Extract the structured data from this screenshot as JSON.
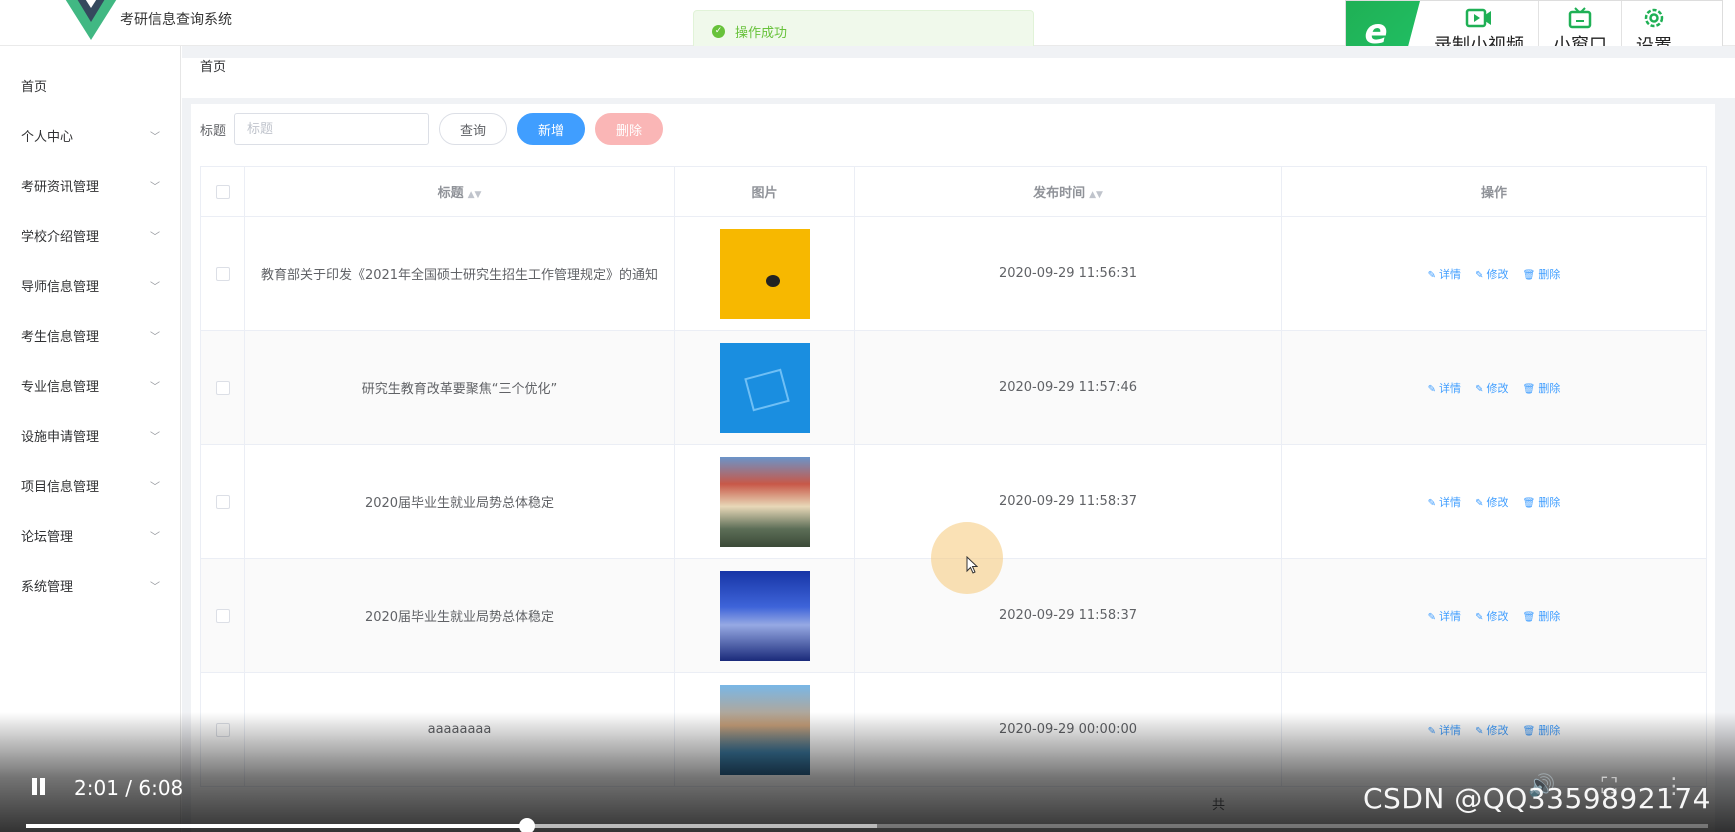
{
  "header": {
    "app_title": "考研信息查询系统",
    "toast": "操作成功"
  },
  "ext_toolbar": {
    "items": [
      {
        "label": "录制小视频",
        "icon": "video-record-icon"
      },
      {
        "label": "小窗口",
        "icon": "tv-icon"
      },
      {
        "label": "设置",
        "icon": "gear-icon"
      }
    ]
  },
  "sidebar": {
    "items": [
      {
        "label": "首页",
        "expandable": false
      },
      {
        "label": "个人中心",
        "expandable": true
      },
      {
        "label": "考研资讯管理",
        "expandable": true
      },
      {
        "label": "学校介绍管理",
        "expandable": true
      },
      {
        "label": "导师信息管理",
        "expandable": true
      },
      {
        "label": "考生信息管理",
        "expandable": true
      },
      {
        "label": "专业信息管理",
        "expandable": true
      },
      {
        "label": "设施申请管理",
        "expandable": true
      },
      {
        "label": "项目信息管理",
        "expandable": true
      },
      {
        "label": "论坛管理",
        "expandable": true
      },
      {
        "label": "系统管理",
        "expandable": true
      }
    ]
  },
  "breadcrumb": "首页",
  "search": {
    "label": "标题",
    "placeholder": "标题",
    "value": "",
    "query_label": "查询",
    "add_label": "新增",
    "delete_label": "删除"
  },
  "table": {
    "headers": {
      "title": "标题",
      "image": "图片",
      "time": "发布时间",
      "ops": "操作"
    },
    "actions": {
      "detail": "详情",
      "edit": "修改",
      "delete": "删除"
    },
    "rows": [
      {
        "title": "教育部关于印发《2021年全国硕士研究生招生工作管理规定》的通知",
        "time": "2020-09-29 11:56:31"
      },
      {
        "title": "研究生教育改革要聚焦“三个优化”",
        "time": "2020-09-29 11:57:46"
      },
      {
        "title": "2020届毕业生就业局势总体稳定",
        "time": "2020-09-29 11:58:37"
      },
      {
        "title": "2020届毕业生就业局势总体稳定",
        "time": "2020-09-29 11:58:37"
      },
      {
        "title": "aaaaaaaa",
        "time": "2020-09-29 00:00:00"
      }
    ]
  },
  "pager": {
    "prefix": "共"
  },
  "player": {
    "time": "2:01 / 6:08",
    "progress": 0.298,
    "buffered": 0.506,
    "watermark": "CSDN @QQ3359892174"
  },
  "colors": {
    "primary": "#409eff",
    "success": "#67c23a",
    "danger_light": "#fab6b6",
    "ext_brand": "#1fb055"
  }
}
